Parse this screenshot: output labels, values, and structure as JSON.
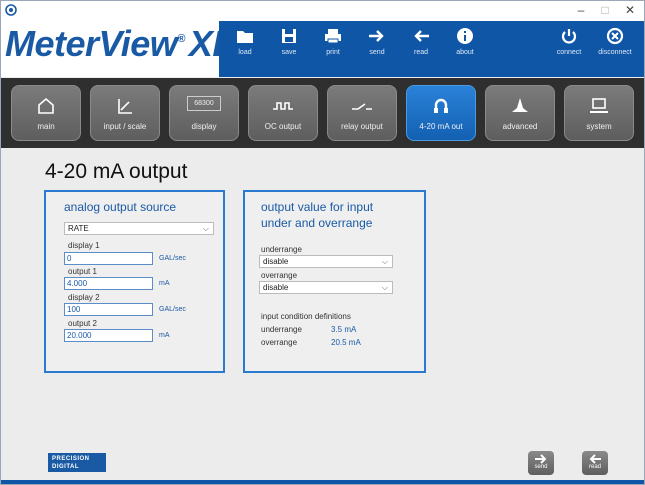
{
  "window": {
    "controls": {
      "minimize": "–",
      "maximize": "□",
      "close": "✕"
    }
  },
  "app": {
    "logo_text": "MeterView",
    "logo_reg": "®",
    "logo_suffix": "XL"
  },
  "toolbar": {
    "items": [
      {
        "label": "load",
        "icon": "folder-icon"
      },
      {
        "label": "save",
        "icon": "save-icon"
      },
      {
        "label": "print",
        "icon": "print-icon"
      },
      {
        "label": "send",
        "icon": "send-arrow-icon"
      },
      {
        "label": "read",
        "icon": "read-arrow-icon"
      },
      {
        "label": "about",
        "icon": "info-icon"
      },
      {
        "label": "connect",
        "icon": "power-icon"
      },
      {
        "label": "disconnect",
        "icon": "disconnect-icon"
      }
    ]
  },
  "nav": {
    "tabs": [
      {
        "label": "main",
        "icon": "home-icon",
        "active": false
      },
      {
        "label": "input / scale",
        "icon": "chart-axis-icon",
        "active": false
      },
      {
        "label": "display",
        "icon": "display-icon",
        "display_text": "68300",
        "active": false
      },
      {
        "label": "OC output",
        "icon": "pulse-icon",
        "active": false
      },
      {
        "label": "relay output",
        "icon": "relay-icon",
        "active": false
      },
      {
        "label": "4-20 mA out",
        "icon": "loop-icon",
        "active": true
      },
      {
        "label": "advanced",
        "icon": "advanced-icon",
        "active": false
      },
      {
        "label": "system",
        "icon": "laptop-icon",
        "active": false
      }
    ]
  },
  "page": {
    "title": "4-20 mA output"
  },
  "analog_source": {
    "heading": "analog output source",
    "source_value": "RATE",
    "display1_label": "display 1",
    "display1_value": "0",
    "display1_unit": "GAL/sec",
    "output1_label": "output 1",
    "output1_value": "4.000",
    "output1_unit": "mA",
    "display2_label": "display 2",
    "display2_value": "100",
    "display2_unit": "GAL/sec",
    "output2_label": "output 2",
    "output2_value": "20.000",
    "output2_unit": "mA"
  },
  "range_output": {
    "heading_line1": "output value for input",
    "heading_line2": "under and overrange",
    "underrange_label": "underrange",
    "underrange_value": "disable",
    "overrange_label": "overrange",
    "overrange_value": "disable",
    "definitions_title": "input condition definitions",
    "def_underrange_label": "underrange",
    "def_underrange_value": "3.5 mA",
    "def_overrange_label": "overrange",
    "def_overrange_value": "20.5 mA"
  },
  "footer": {
    "brand_line1": "PRECISION",
    "brand_line2": "DIGITAL",
    "send_label": "send",
    "read_label": "read"
  },
  "colors": {
    "brand_blue": "#0f57a6",
    "accent_blue": "#2b7ad0",
    "nav_bg": "#2f2f2f"
  }
}
